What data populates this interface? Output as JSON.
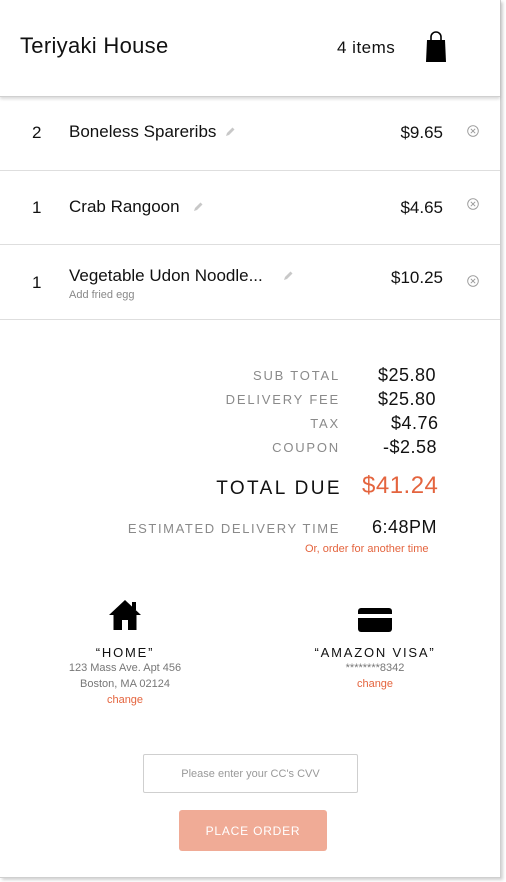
{
  "header": {
    "restaurant_name": "Teriyaki House",
    "item_count": "4 items",
    "cart_icon": "shopping-bag-icon"
  },
  "order_items": [
    {
      "qty": "2",
      "name": "Boneless Spareribs",
      "price": "$9.65",
      "note": ""
    },
    {
      "qty": "1",
      "name": "Crab Rangoon",
      "price": "$4.65",
      "note": ""
    },
    {
      "qty": "1",
      "name": "Vegetable Udon Noodle...",
      "price": "$10.25",
      "note": "Add fried egg"
    }
  ],
  "summary": {
    "subtotal_label": "SUB TOTAL",
    "subtotal_value": "$25.80",
    "delivery_fee_label": "DELIVERY FEE",
    "delivery_fee_value": "$25.80",
    "tax_label": "TAX",
    "tax_value": "$4.76",
    "coupon_label": "COUPON",
    "coupon_value": "-$2.58",
    "total_label": "TOTAL DUE",
    "total_value": "$41.24",
    "eta_label": "ESTIMATED DELIVERY TIME",
    "eta_value": "6:48PM",
    "other_time_link": "Or, order for another time"
  },
  "address": {
    "icon": "home-icon",
    "title": "“HOME”",
    "line1": "123 Mass Ave. Apt 456",
    "line2": "Boston, MA 02124",
    "change_link": "change"
  },
  "payment": {
    "icon": "credit-card-icon",
    "title": "“AMAZON VISA”",
    "masked_number": "********8342",
    "change_link": "change"
  },
  "cvv": {
    "placeholder": "Please enter your CC's CVV",
    "value": ""
  },
  "place_order_label": "PLACE ORDER",
  "colors": {
    "accent": "#e4643e",
    "button": "#f0ab96",
    "muted": "#8a8a8a"
  }
}
